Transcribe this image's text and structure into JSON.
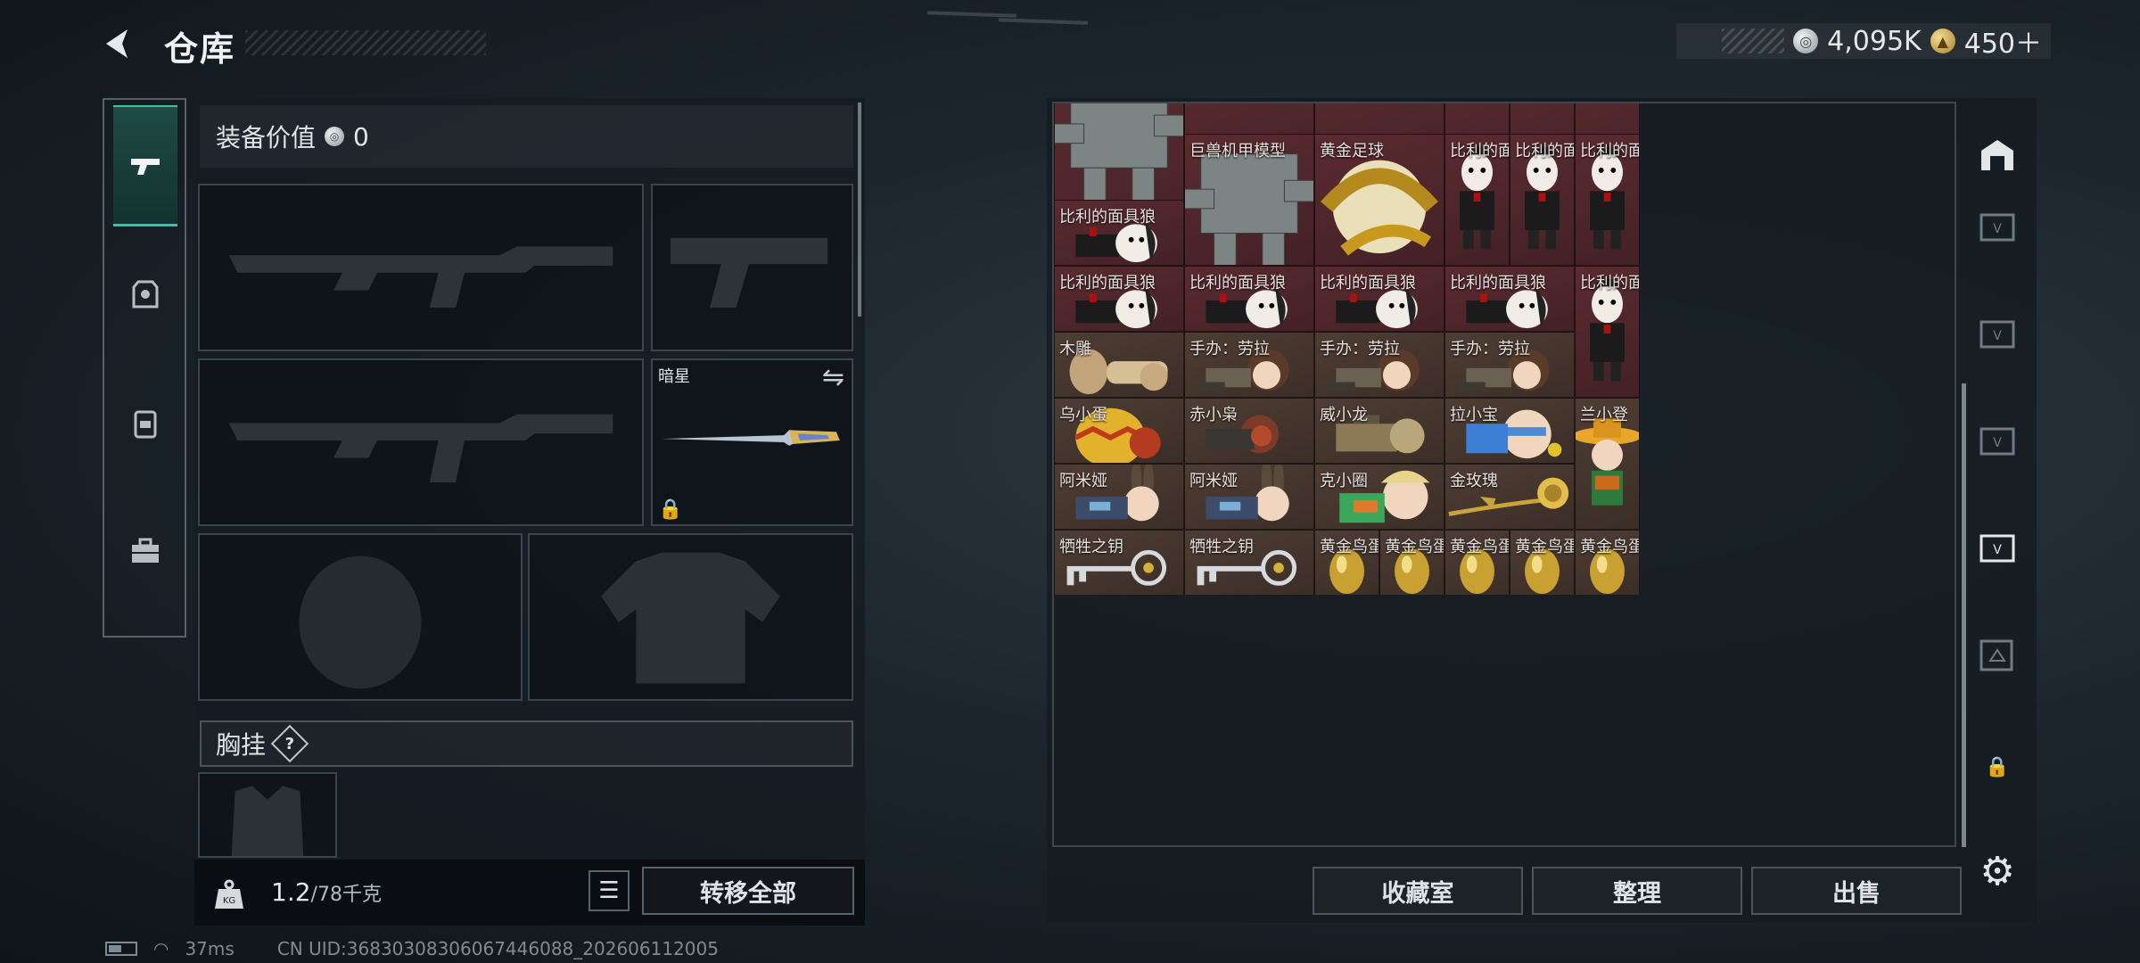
{
  "header": {
    "title": "仓库",
    "silver_amount": "4,095K",
    "gold_amount": "450＋"
  },
  "equipment": {
    "value_label": "装备价值",
    "value": "0",
    "melee_name": "暗星",
    "chest_label": "胸挂",
    "chest_help": "?",
    "weight_value": "1.2",
    "weight_cap": "/78千克",
    "move_all_label": "转移全部"
  },
  "storage": {
    "cells": [
      {
        "name": "巨兽机甲模型",
        "bg": "red",
        "icon": "mech"
      },
      {
        "name": "黄金足球",
        "bg": "red",
        "icon": "ball"
      },
      {
        "name": "比利的面…",
        "bg": "red",
        "icon": "puppet"
      },
      {
        "name": "比利的面…",
        "bg": "red",
        "icon": "puppet"
      },
      {
        "name": "比利的面…",
        "bg": "red",
        "icon": "puppet"
      },
      {
        "name": "比利的面具狼",
        "bg": "red",
        "icon": "puppet_lying"
      },
      {
        "name": "比利的面具狼",
        "bg": "red",
        "icon": "puppet_lying"
      },
      {
        "name": "比利的面具狼",
        "bg": "red",
        "icon": "puppet_lying"
      },
      {
        "name": "比利的面具狼",
        "bg": "red",
        "icon": "puppet_lying"
      },
      {
        "name": "比利的面具狼",
        "bg": "red",
        "icon": "puppet_lying"
      },
      {
        "name": "比利的面…",
        "bg": "red",
        "icon": "puppet"
      },
      {
        "name": "木雕",
        "bg": "brown",
        "icon": "carving"
      },
      {
        "name": "手办：劳拉",
        "bg": "brown",
        "icon": "lara"
      },
      {
        "name": "手办：劳拉",
        "bg": "brown",
        "icon": "lara"
      },
      {
        "name": "手办：劳拉",
        "bg": "brown",
        "icon": "lara"
      },
      {
        "name": "乌小蛋",
        "bg": "brown",
        "icon": "egg_figure"
      },
      {
        "name": "赤小枭",
        "bg": "brown",
        "icon": "figure_red"
      },
      {
        "name": "威小龙",
        "bg": "brown",
        "icon": "figure_khaki"
      },
      {
        "name": "拉小宝",
        "bg": "brown",
        "icon": "figure_blue"
      },
      {
        "name": "兰小登",
        "bg": "brown",
        "icon": "sombrero"
      },
      {
        "name": "阿米娅",
        "bg": "brown",
        "icon": "bunny"
      },
      {
        "name": "阿米娅",
        "bg": "brown",
        "icon": "bunny"
      },
      {
        "name": "克小圈",
        "bg": "brown",
        "icon": "figure_green"
      },
      {
        "name": "金玫瑰",
        "bg": "brown",
        "icon": "rose"
      },
      {
        "name": "牺牲之钥",
        "bg": "brown",
        "icon": "key"
      },
      {
        "name": "牺牲之钥",
        "bg": "brown",
        "icon": "key"
      },
      {
        "name": "黄金鸟蛋",
        "bg": "brown",
        "icon": "gold_egg"
      },
      {
        "name": "黄金鸟蛋",
        "bg": "brown",
        "icon": "gold_egg"
      },
      {
        "name": "黄金鸟蛋",
        "bg": "brown",
        "icon": "gold_egg"
      },
      {
        "name": "黄金鸟蛋",
        "bg": "brown",
        "icon": "gold_egg"
      },
      {
        "name": "黄金鸟蛋",
        "bg": "brown",
        "icon": "gold_egg"
      }
    ],
    "buttons": {
      "collection": "收藏室",
      "organize": "整理",
      "sell": "出售"
    }
  },
  "status": {
    "ping": "37ms",
    "uid": "CN UID:3683030830606744608​8_202606112005"
  }
}
